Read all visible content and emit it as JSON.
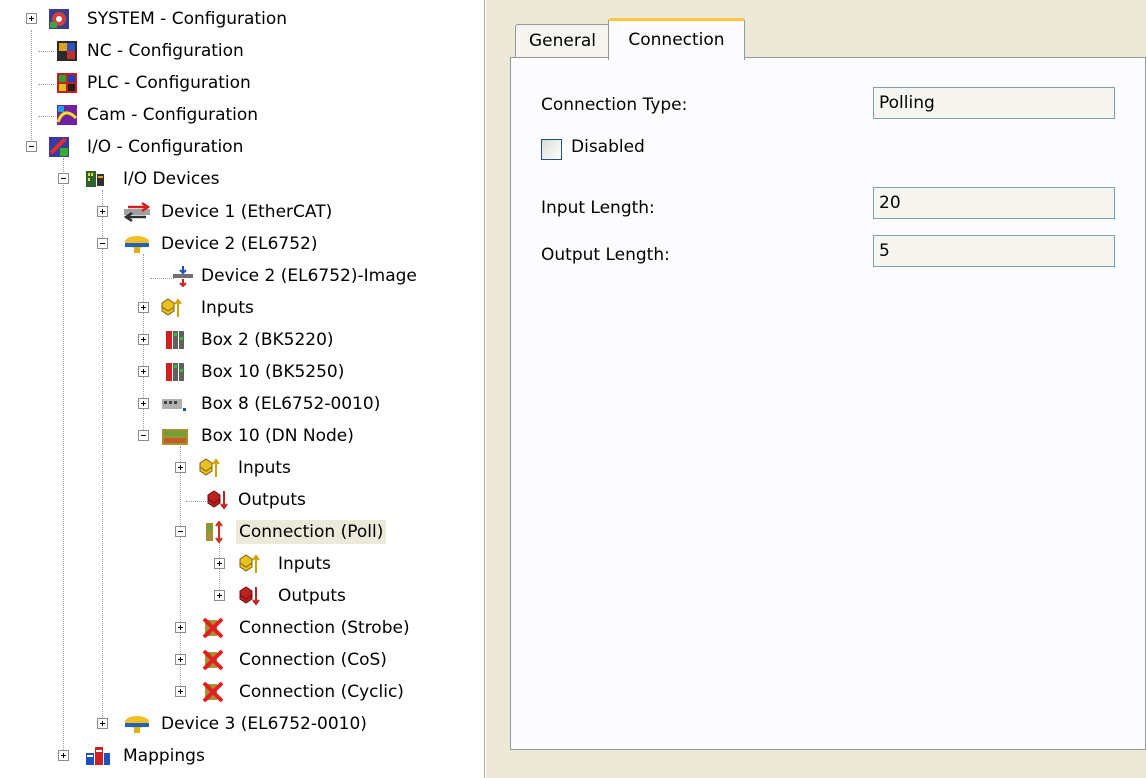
{
  "tree": {
    "system": {
      "label": "SYSTEM - Configuration"
    },
    "nc": {
      "label": "NC - Configuration"
    },
    "plc": {
      "label": "PLC - Configuration"
    },
    "cam": {
      "label": "Cam - Configuration"
    },
    "io": {
      "label": "I/O - Configuration"
    },
    "io_devices": {
      "label": "I/O Devices"
    },
    "device1": {
      "label": "Device 1 (EtherCAT)"
    },
    "device2": {
      "label": "Device 2 (EL6752)"
    },
    "device2_image": {
      "label": "Device 2 (EL6752)-Image"
    },
    "device2_inputs": {
      "label": "Inputs"
    },
    "box2": {
      "label": "Box 2 (BK5220)"
    },
    "box10_bk": {
      "label": "Box 10 (BK5250)"
    },
    "box8": {
      "label": "Box 8 (EL6752-0010)"
    },
    "box10_dn": {
      "label": "Box 10 (DN Node)"
    },
    "box10_inputs": {
      "label": "Inputs"
    },
    "box10_outputs": {
      "label": "Outputs"
    },
    "conn_poll": {
      "label": "Connection (Poll)",
      "selected": true
    },
    "conn_poll_inputs": {
      "label": "Inputs"
    },
    "conn_poll_outputs": {
      "label": "Outputs"
    },
    "conn_strobe": {
      "label": "Connection (Strobe)"
    },
    "conn_cos": {
      "label": "Connection (CoS)"
    },
    "conn_cyclic": {
      "label": "Connection (Cyclic)"
    },
    "device3": {
      "label": "Device 3 (EL6752-0010)"
    },
    "mappings": {
      "label": "Mappings"
    }
  },
  "tabs": {
    "general": "General",
    "connection": "Connection",
    "active": "connection"
  },
  "form": {
    "connection_type_label": "Connection Type:",
    "connection_type_value": "Polling",
    "disabled_label": "Disabled",
    "disabled_checked": false,
    "input_length_label": "Input Length:",
    "input_length_value": "20",
    "output_length_label": "Output Length:",
    "output_length_value": "5"
  },
  "colors": {
    "tab_accent": "#ffc83c",
    "selection": "#ece9d8",
    "panel_bg": "#ece9d8",
    "field_border": "#7f9db9"
  }
}
